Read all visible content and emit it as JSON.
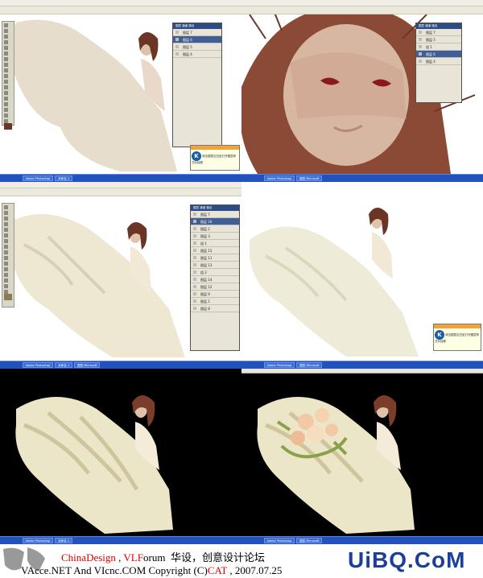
{
  "screens": {
    "menu": [
      "文件(F)",
      "编辑(E)",
      "图像(I)",
      "图层(L)",
      "选择(S)",
      "滤镜(T)",
      "视图(V)",
      "窗口(W)",
      "帮助(H)"
    ],
    "taskbar": {
      "start": "start",
      "items": [
        "Adobe Photoshop",
        "未命名-1",
        "图层-Microsoft"
      ]
    },
    "popup_text": "双击图层空白处打开图层样式对话框",
    "layers_panel": {
      "title": "图层 通道 路径",
      "rows_small": [
        "图层 7",
        "图层 6",
        "图层 5",
        "图层 4"
      ],
      "rows_tall": [
        "图层 7",
        "图层 16",
        "图层 2",
        "图层 3",
        "组 1",
        "图层 15",
        "图层 11",
        "图层 13",
        "组 2",
        "图层 14",
        "图层 12",
        "图层 9",
        "图层 1",
        "图层 8"
      ],
      "rows_right": [
        "图层 7",
        "图层 5",
        "组 1",
        "图层 6",
        "图层 4"
      ]
    }
  },
  "footer": {
    "line1_a": "China",
    "line1_b": "Design",
    "line1_c": " , ",
    "line1_d": "VLF",
    "line1_e": "orum",
    "line1_cn": "华设，创意设计论坛",
    "line2_a": "VAcce.NET  And  VIcnc.COM  Copyright (C)",
    "line2_b": "CAT",
    "line2_c": " , 2007.07.25",
    "brand": "UiBQ.CoM",
    "colors": {
      "red": "#dd0000",
      "brand": "#1b3f9a"
    }
  }
}
